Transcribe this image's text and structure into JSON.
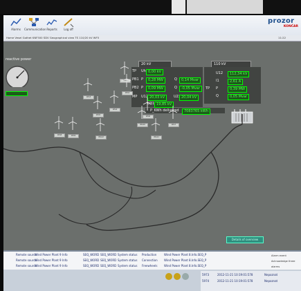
{
  "toolbar": {
    "buttons": [
      {
        "name": "alarm-button",
        "label": "Alarms"
      },
      {
        "name": "communication-button",
        "label": "Communication"
      },
      {
        "name": "reports-button",
        "label": "Reports"
      },
      {
        "name": "logoff-button",
        "label": "Log off"
      }
    ],
    "brand_name": "prozor",
    "brand_company": "KONČAR",
    "time": "11:22"
  },
  "breadcrumb": "Home   Vesel Gothet  KNF500  SDV  Geographical view  TS 110/20 kV  WF5",
  "main": {
    "reactive_power_label": "reactive power",
    "panel_20kv": {
      "title": "20 kV",
      "side_labels": [
        "TP",
        "PB1",
        "PB2",
        "MP"
      ],
      "u_label": "Uh",
      "u_value": "0,00 kV",
      "p1_label": "P",
      "p1_value": "0,28 MW",
      "q1_label": "Q",
      "q1_value": "0,14 Mvar",
      "p2_label": "P",
      "p2_value": "0,09 MW",
      "q2_label": "Q",
      "q2_value": "-0,05 Mvar",
      "u12_label": "U12",
      "u12_value": "20,03 kV",
      "u23_label": "U23",
      "u23_value": "20,04 kV",
      "u31_label": "U31",
      "u31_value": "19,85 kV",
      "delivered_label": "P_KWh delivered",
      "delivered_value": "7083765 kWh"
    },
    "panel_110kv": {
      "title": "110 kV",
      "side_label": "TP",
      "rows": [
        {
          "label": "U12",
          "value": "112,34 kV"
        },
        {
          "label": "I1",
          "value": "2,61 A"
        },
        {
          "label": "P",
          "value": "0,39 MW"
        },
        {
          "label": "Q",
          "value": "0,05 Mvar"
        }
      ]
    },
    "turbines": [
      "WG1",
      "WG2",
      "WG3",
      "WG4",
      "WG5",
      "WG6",
      "WG7",
      "WG8",
      "WG9",
      "WG10",
      "WG11",
      "WG12"
    ],
    "detail_button": "Details of overview"
  },
  "events": [
    {
      "a": "Remote source",
      "b": "Wind Power Plant 9",
      "c": "Info",
      "d": "SEQ_WORD",
      "e": "SEQ_WORD",
      "f": "System status",
      "g": "Production",
      "h": "Wind Power Plant 8.Info.SEQ_P"
    },
    {
      "a": "Remote source",
      "b": "Wind Power Plant 9",
      "c": "Info",
      "d": "SEQ_WORD",
      "e": "SEQ_WORD",
      "f": "System status",
      "g": "Connection",
      "h": "Wind Power Plant 8.Info.SEQ_P"
    },
    {
      "a": "Remote source",
      "b": "Wind Power Plant 9",
      "c": "Info",
      "d": "SEQ_WORD",
      "e": "SEQ_WORD",
      "f": "System status",
      "g": "Freewheels",
      "h": "Wind Power Plant 8.Info.SEQ_P"
    }
  ],
  "side_legend": [
    "Alarm event",
    "Acknowledge three alarms",
    "Acknowledge all alarms"
  ],
  "status": [
    {
      "id": "5973",
      "time": "2012-11-21 10:19:01:578",
      "text": "Nepoznat"
    },
    {
      "id": "5974",
      "time": "2012-11-21 10:19:01:578",
      "text": "Nepoznat"
    }
  ],
  "colors": {
    "toolbar": "#e8ecf2",
    "scada_bg": "#6b6f6c",
    "value_green": "#59ff59",
    "brand_blue": "#1c4e8c"
  }
}
